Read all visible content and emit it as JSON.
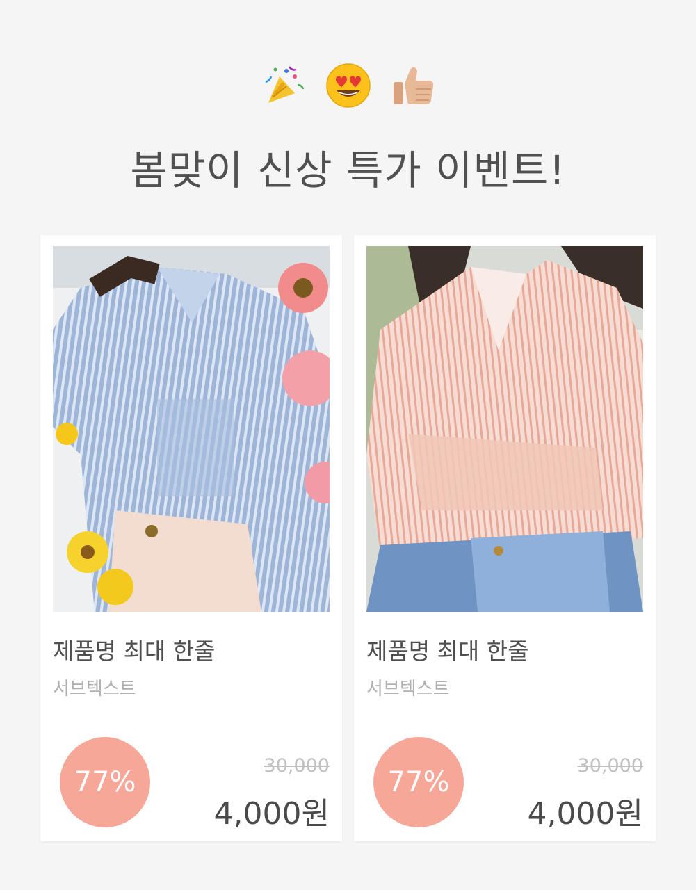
{
  "header": {
    "emojis": [
      "party-popper-icon",
      "heart-eyes-icon",
      "thumbs-up-icon"
    ],
    "title": "봄맞이 신상 특가 이벤트!"
  },
  "products": [
    {
      "name": "제품명 최대 한줄",
      "subtext": "서브텍스트",
      "discount": "77%",
      "original_price": "30,000",
      "price": "4,000원",
      "image": "blue-striped-shirt-photo"
    },
    {
      "name": "제품명 최대 한줄",
      "subtext": "서브텍스트",
      "discount": "77%",
      "original_price": "30,000",
      "price": "4,000원",
      "image": "pink-striped-shirt-photo"
    }
  ],
  "colors": {
    "background": "#f5f5f6",
    "discount_badge": "#f7a797",
    "title_text": "#505050"
  }
}
